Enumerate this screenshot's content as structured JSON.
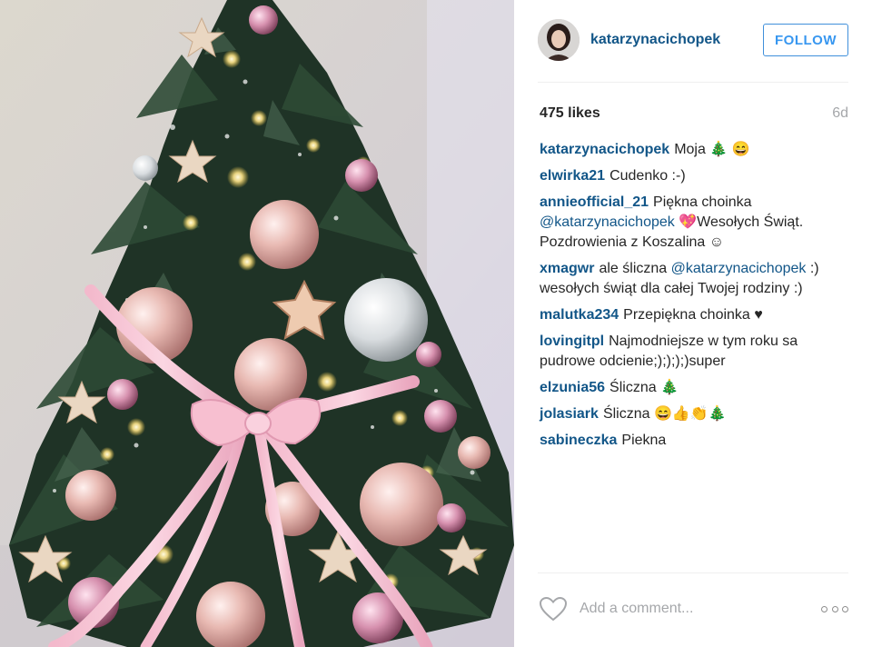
{
  "post": {
    "author": "katarzynacichopek",
    "follow_label": "FOLLOW",
    "likes": "475 likes",
    "time": "6d",
    "comments": [
      {
        "author": "katarzynacichopek",
        "parts": [
          {
            "t": "Moja 🎄 😄"
          }
        ]
      },
      {
        "author": "elwirka21",
        "parts": [
          {
            "t": "Cudenko :-)"
          }
        ]
      },
      {
        "author": "annieofficial_21",
        "parts": [
          {
            "t": "Piękna choinka "
          },
          {
            "t": "@katarzynacichopek",
            "m": true
          },
          {
            "t": " 💖Wesołych Świąt. Pozdrowienia z Koszalina ☺"
          }
        ]
      },
      {
        "author": "xmagwr",
        "parts": [
          {
            "t": "ale śliczna "
          },
          {
            "t": "@katarzynacichopek",
            "m": true
          },
          {
            "t": " :) wesołych świąt dla całej Twojej rodziny :)"
          }
        ]
      },
      {
        "author": "malutka234",
        "parts": [
          {
            "t": "Przepiękna choinka ♥"
          }
        ]
      },
      {
        "author": "lovingitpl",
        "parts": [
          {
            "t": "Najmodniejsze w tym roku sa pudrowe odcienie;);););)super"
          }
        ]
      },
      {
        "author": "elzunia56",
        "parts": [
          {
            "t": "Śliczna 🎄"
          }
        ]
      },
      {
        "author": "jolasiark",
        "parts": [
          {
            "t": "Śliczna 😄👍👏🎄"
          }
        ]
      },
      {
        "author": "sabineczka",
        "parts": [
          {
            "t": "Piekna"
          }
        ]
      }
    ],
    "comment_placeholder": "Add a comment...",
    "icons": {
      "like": "heart-outline-icon",
      "more": "more-options-icon"
    },
    "colors": {
      "username": "#125688",
      "follow": "#3897f0",
      "muted": "#a5a7aa"
    }
  }
}
